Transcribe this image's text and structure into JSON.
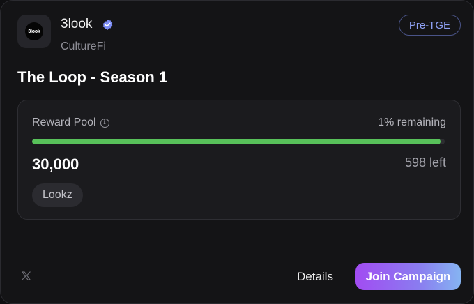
{
  "header": {
    "logo_text": "3look",
    "name": "3look",
    "subtitle": "CultureFi",
    "badge": "Pre-TGE",
    "verified_icon": "verified-check-icon",
    "accent_color": "#7c8cf4"
  },
  "campaign": {
    "title": "The Loop - Season 1"
  },
  "reward_pool": {
    "label": "Reward Pool",
    "info_icon": "info-icon",
    "remaining_text": "1% remaining",
    "progress_fraction": 0.99,
    "progress_color": "#58c15a",
    "amount": "30,000",
    "left_text": "598 left",
    "token": "Lookz"
  },
  "footer": {
    "social_icon": "x-logo-icon",
    "details_label": "Details",
    "join_label": "Join Campaign"
  }
}
